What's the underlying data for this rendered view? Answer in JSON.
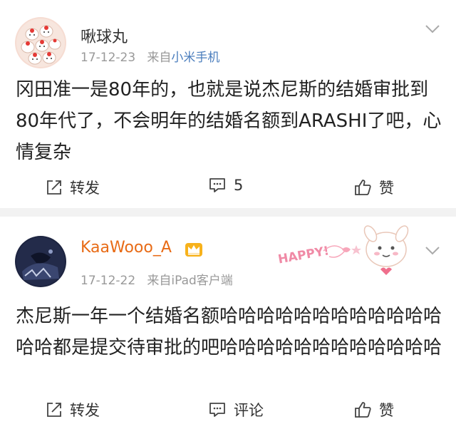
{
  "posts": [
    {
      "username": "啾球丸",
      "timestamp": "17-12-23",
      "source_prefix": "来自",
      "source": "小米手机",
      "text": "冈田准一是80年的，也就是说杰尼斯的结婚审批到80年代了，不会明年的结婚名额到ARASHI了吧，心情复杂",
      "actions": {
        "repost": "转发",
        "comment": "5",
        "like": "赞"
      }
    },
    {
      "username": "KaaWooo_A",
      "timestamp": "17-12-22",
      "source_prefix": "来自",
      "source": "iPad客户端",
      "text": "杰尼斯一年一个结婚名额哈哈哈哈哈哈哈哈哈哈哈哈哈哈都是提交待审批的吧哈哈哈哈哈哈哈哈哈哈哈哈",
      "sticker_text": "HAPPY!",
      "actions": {
        "repost": "转发",
        "comment": "评论",
        "like": "赞"
      }
    }
  ],
  "colors": {
    "username_highlight": "#e86b16",
    "source_link": "#4a7dbd",
    "meta": "#999999",
    "divider": "#f2f2f2"
  }
}
